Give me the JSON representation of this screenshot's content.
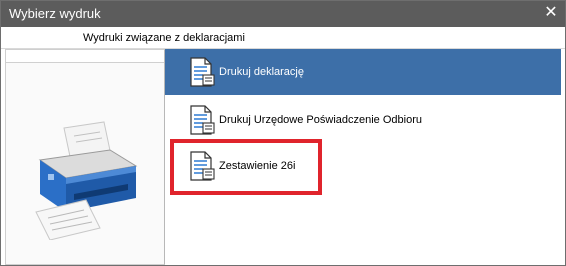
{
  "window": {
    "title": "Wybierz wydruk",
    "close_glyph": "✕"
  },
  "tab": {
    "label": "Wydruki związane z deklaracjami"
  },
  "sidebar": {
    "icon": "printer-icon",
    "accent_color": "#2b6fc7"
  },
  "list": {
    "selected_color": "#3d6fa8",
    "items": [
      {
        "label": "Drukuj deklarację",
        "icon": "document-icon",
        "selected": true
      },
      {
        "label": "Drukuj Urzędowe Poświadczenie Odbioru",
        "icon": "document-icon",
        "selected": false
      },
      {
        "label": "Zestawienie 26i",
        "icon": "document-icon",
        "selected": false
      }
    ]
  },
  "highlight": {
    "color": "#e0242c",
    "target": "Zestawienie 26i"
  }
}
